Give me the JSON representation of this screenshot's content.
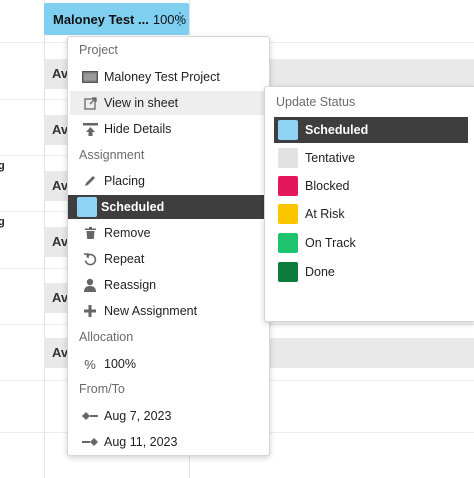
{
  "chip": {
    "name": "Maloney Test ...",
    "allocation": "100%"
  },
  "background": {
    "avail_label": "Av",
    "row_label": "g"
  },
  "menu": {
    "project_header": "Project",
    "project_name": "Maloney Test Project",
    "view_in_sheet": "View in sheet",
    "hide_details": "Hide Details",
    "assignment_header": "Assignment",
    "placing": "Placing",
    "scheduled": "Scheduled",
    "remove": "Remove",
    "repeat": "Repeat",
    "reassign": "Reassign",
    "new_assignment": "New Assignment",
    "allocation_header": "Allocation",
    "allocation_value": "100%",
    "fromto_header": "From/To",
    "from_date": "Aug 7, 2023",
    "to_date": "Aug 11, 2023"
  },
  "status_menu": {
    "header": "Update Status",
    "options": [
      {
        "label": "Scheduled",
        "color": "#8fd3f4"
      },
      {
        "label": "Tentative",
        "color": "#e2e2e2"
      },
      {
        "label": "Blocked",
        "color": "#e3175a"
      },
      {
        "label": "At Risk",
        "color": "#f9c600"
      },
      {
        "label": "On Track",
        "color": "#1ec36f"
      },
      {
        "label": "Done",
        "color": "#0b7a3b"
      }
    ]
  },
  "colors": {
    "chip": "#7fcff1",
    "active": "#3e3e3e",
    "hover": "#eeeeee"
  }
}
